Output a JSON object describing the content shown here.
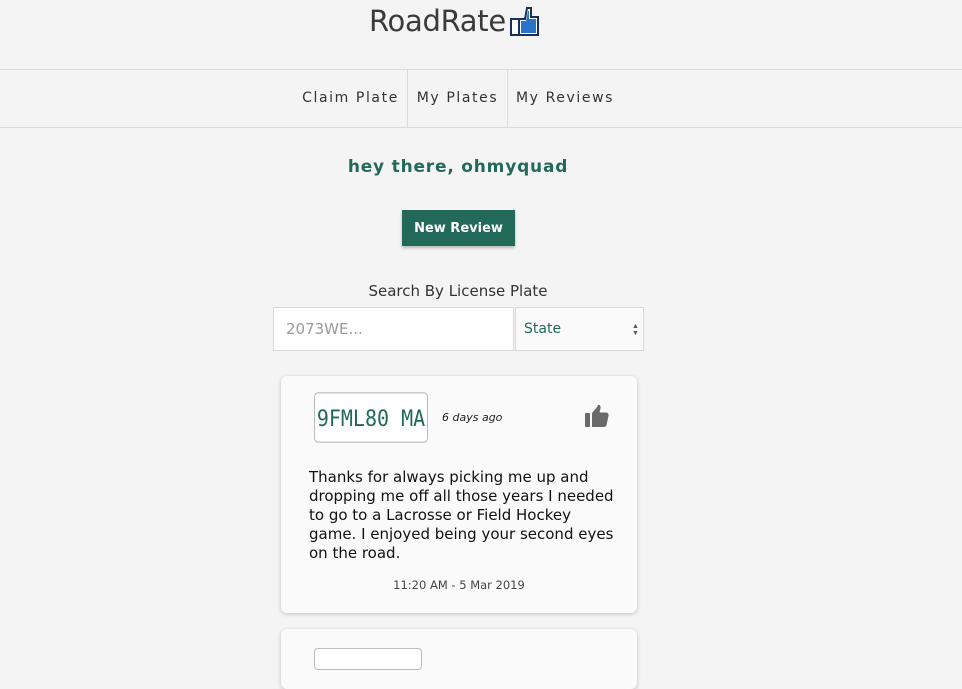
{
  "app": {
    "title": "RoadRate"
  },
  "nav": {
    "items": [
      {
        "label": "Claim Plate"
      },
      {
        "label": "My Plates"
      },
      {
        "label": "My Reviews"
      }
    ]
  },
  "greeting": "hey there, ohmyquad",
  "new_review_label": "New Review",
  "search": {
    "label": "Search By License Plate",
    "placeholder": "2073WE...",
    "value": "",
    "state_selected": "State"
  },
  "reviews": [
    {
      "plate": "9FML80 MA",
      "time_ago": "6 days ago",
      "text": "Thanks for always picking me up and dropping me off all those years I needed to go to a Lacrosse or Field Hockey game. I enjoyed being your second eyes on the road.",
      "timestamp": "11:20 AM - 5 Mar 2019",
      "icon": "thumbs-up-icon"
    }
  ],
  "colors": {
    "accent": "#23695a",
    "background": "#f4f4f4",
    "card": "#fafafa",
    "logo_icon_blue": "#2b73c9",
    "logo_icon_dark": "#1b2f5c"
  }
}
